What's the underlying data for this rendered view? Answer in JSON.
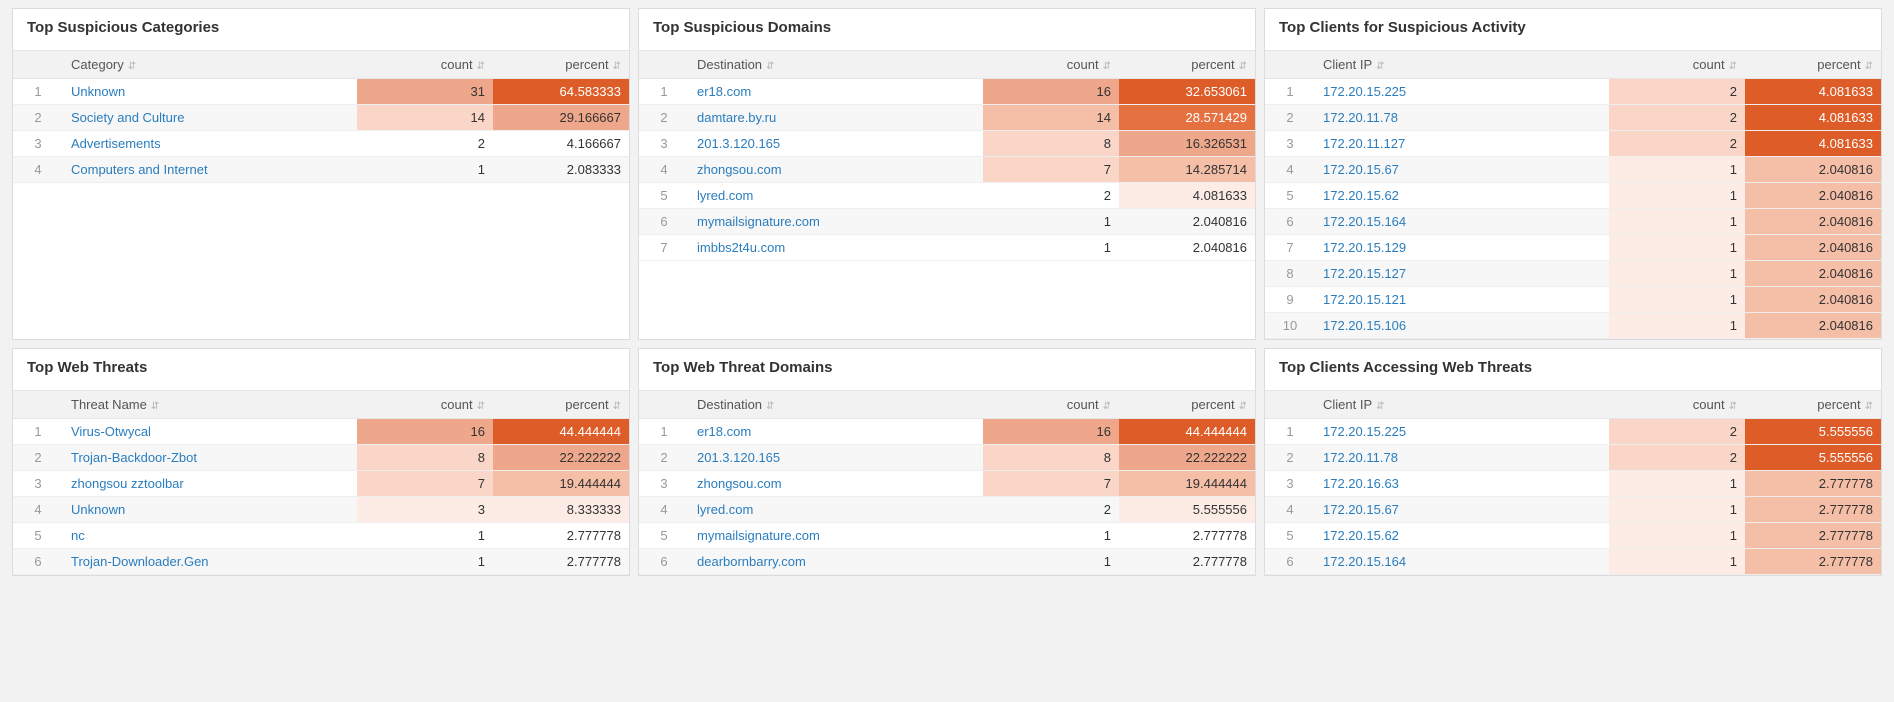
{
  "panels": [
    {
      "id": "suspicious-categories",
      "title": "Top Suspicious Categories",
      "columns": [
        "",
        "Category",
        "count",
        "percent"
      ],
      "rows": [
        {
          "idx": 1,
          "label": "Unknown",
          "count": 31,
          "percent": "64.583333",
          "ch": "heat-4",
          "ph": "heat-7"
        },
        {
          "idx": 2,
          "label": "Society and Culture",
          "count": 14,
          "percent": "29.166667",
          "ch": "heat-2",
          "ph": "heat-4"
        },
        {
          "idx": 3,
          "label": "Advertisements",
          "count": 2,
          "percent": "4.166667",
          "ch": "heat-nc",
          "ph": "heat-nc"
        },
        {
          "idx": 4,
          "label": "Computers and Internet",
          "count": 1,
          "percent": "2.083333",
          "ch": "heat-nc",
          "ph": "heat-nc"
        }
      ]
    },
    {
      "id": "suspicious-domains",
      "title": "Top Suspicious Domains",
      "columns": [
        "",
        "Destination",
        "count",
        "percent"
      ],
      "rows": [
        {
          "idx": 1,
          "label": "er18.com",
          "count": 16,
          "percent": "32.653061",
          "ch": "heat-4",
          "ph": "heat-7"
        },
        {
          "idx": 2,
          "label": "damtare.by.ru",
          "count": 14,
          "percent": "28.571429",
          "ch": "heat-3",
          "ph": "heat-6"
        },
        {
          "idx": 3,
          "label": "201.3.120.165",
          "count": 8,
          "percent": "16.326531",
          "ch": "heat-2",
          "ph": "heat-4"
        },
        {
          "idx": 4,
          "label": "zhongsou.com",
          "count": 7,
          "percent": "14.285714",
          "ch": "heat-2",
          "ph": "heat-3"
        },
        {
          "idx": 5,
          "label": "lyred.com",
          "count": 2,
          "percent": "4.081633",
          "ch": "heat-nc",
          "ph": "heat-1"
        },
        {
          "idx": 6,
          "label": "mymailsignature.com",
          "count": 1,
          "percent": "2.040816",
          "ch": "heat-nc",
          "ph": "heat-nc"
        },
        {
          "idx": 7,
          "label": "imbbs2t4u.com",
          "count": 1,
          "percent": "2.040816",
          "ch": "heat-nc",
          "ph": "heat-nc"
        }
      ]
    },
    {
      "id": "clients-suspicious",
      "title": "Top Clients for Suspicious Activity",
      "columns": [
        "",
        "Client IP",
        "count",
        "percent"
      ],
      "rows": [
        {
          "idx": 1,
          "label": "172.20.15.225",
          "count": 2,
          "percent": "4.081633",
          "ch": "heat-2",
          "ph": "heat-7"
        },
        {
          "idx": 2,
          "label": "172.20.11.78",
          "count": 2,
          "percent": "4.081633",
          "ch": "heat-2",
          "ph": "heat-7"
        },
        {
          "idx": 3,
          "label": "172.20.11.127",
          "count": 2,
          "percent": "4.081633",
          "ch": "heat-2",
          "ph": "heat-7"
        },
        {
          "idx": 4,
          "label": "172.20.15.67",
          "count": 1,
          "percent": "2.040816",
          "ch": "heat-1",
          "ph": "heat-3"
        },
        {
          "idx": 5,
          "label": "172.20.15.62",
          "count": 1,
          "percent": "2.040816",
          "ch": "heat-1",
          "ph": "heat-3"
        },
        {
          "idx": 6,
          "label": "172.20.15.164",
          "count": 1,
          "percent": "2.040816",
          "ch": "heat-1",
          "ph": "heat-3"
        },
        {
          "idx": 7,
          "label": "172.20.15.129",
          "count": 1,
          "percent": "2.040816",
          "ch": "heat-1",
          "ph": "heat-3"
        },
        {
          "idx": 8,
          "label": "172.20.15.127",
          "count": 1,
          "percent": "2.040816",
          "ch": "heat-1",
          "ph": "heat-3"
        },
        {
          "idx": 9,
          "label": "172.20.15.121",
          "count": 1,
          "percent": "2.040816",
          "ch": "heat-1",
          "ph": "heat-3"
        },
        {
          "idx": 10,
          "label": "172.20.15.106",
          "count": 1,
          "percent": "2.040816",
          "ch": "heat-1",
          "ph": "heat-3"
        }
      ]
    },
    {
      "id": "web-threats",
      "title": "Top Web Threats",
      "columns": [
        "",
        "Threat Name",
        "count",
        "percent"
      ],
      "rows": [
        {
          "idx": 1,
          "label": "Virus-Otwycal",
          "count": 16,
          "percent": "44.444444",
          "ch": "heat-4",
          "ph": "heat-7"
        },
        {
          "idx": 2,
          "label": "Trojan-Backdoor-Zbot",
          "count": 8,
          "percent": "22.222222",
          "ch": "heat-2",
          "ph": "heat-4"
        },
        {
          "idx": 3,
          "label": "zhongsou zztoolbar",
          "count": 7,
          "percent": "19.444444",
          "ch": "heat-2",
          "ph": "heat-3"
        },
        {
          "idx": 4,
          "label": "Unknown",
          "count": 3,
          "percent": "8.333333",
          "ch": "heat-1",
          "ph": "heat-1"
        },
        {
          "idx": 5,
          "label": "nc",
          "count": 1,
          "percent": "2.777778",
          "ch": "heat-nc",
          "ph": "heat-nc"
        },
        {
          "idx": 6,
          "label": "Trojan-Downloader.Gen",
          "count": 1,
          "percent": "2.777778",
          "ch": "heat-nc",
          "ph": "heat-nc"
        }
      ]
    },
    {
      "id": "web-threat-domains",
      "title": "Top Web Threat Domains",
      "columns": [
        "",
        "Destination",
        "count",
        "percent"
      ],
      "rows": [
        {
          "idx": 1,
          "label": "er18.com",
          "count": 16,
          "percent": "44.444444",
          "ch": "heat-4",
          "ph": "heat-7"
        },
        {
          "idx": 2,
          "label": "201.3.120.165",
          "count": 8,
          "percent": "22.222222",
          "ch": "heat-2",
          "ph": "heat-4"
        },
        {
          "idx": 3,
          "label": "zhongsou.com",
          "count": 7,
          "percent": "19.444444",
          "ch": "heat-2",
          "ph": "heat-3"
        },
        {
          "idx": 4,
          "label": "lyred.com",
          "count": 2,
          "percent": "5.555556",
          "ch": "heat-nc",
          "ph": "heat-1"
        },
        {
          "idx": 5,
          "label": "mymailsignature.com",
          "count": 1,
          "percent": "2.777778",
          "ch": "heat-nc",
          "ph": "heat-nc"
        },
        {
          "idx": 6,
          "label": "dearbornbarry.com",
          "count": 1,
          "percent": "2.777778",
          "ch": "heat-nc",
          "ph": "heat-nc"
        }
      ]
    },
    {
      "id": "clients-webthreats",
      "title": "Top Clients Accessing Web Threats",
      "columns": [
        "",
        "Client IP",
        "count",
        "percent"
      ],
      "rows": [
        {
          "idx": 1,
          "label": "172.20.15.225",
          "count": 2,
          "percent": "5.555556",
          "ch": "heat-2",
          "ph": "heat-7"
        },
        {
          "idx": 2,
          "label": "172.20.11.78",
          "count": 2,
          "percent": "5.555556",
          "ch": "heat-2",
          "ph": "heat-7"
        },
        {
          "idx": 3,
          "label": "172.20.16.63",
          "count": 1,
          "percent": "2.777778",
          "ch": "heat-1",
          "ph": "heat-3"
        },
        {
          "idx": 4,
          "label": "172.20.15.67",
          "count": 1,
          "percent": "2.777778",
          "ch": "heat-1",
          "ph": "heat-3"
        },
        {
          "idx": 5,
          "label": "172.20.15.62",
          "count": 1,
          "percent": "2.777778",
          "ch": "heat-1",
          "ph": "heat-3"
        },
        {
          "idx": 6,
          "label": "172.20.15.164",
          "count": 1,
          "percent": "2.777778",
          "ch": "heat-1",
          "ph": "heat-3"
        }
      ]
    }
  ]
}
